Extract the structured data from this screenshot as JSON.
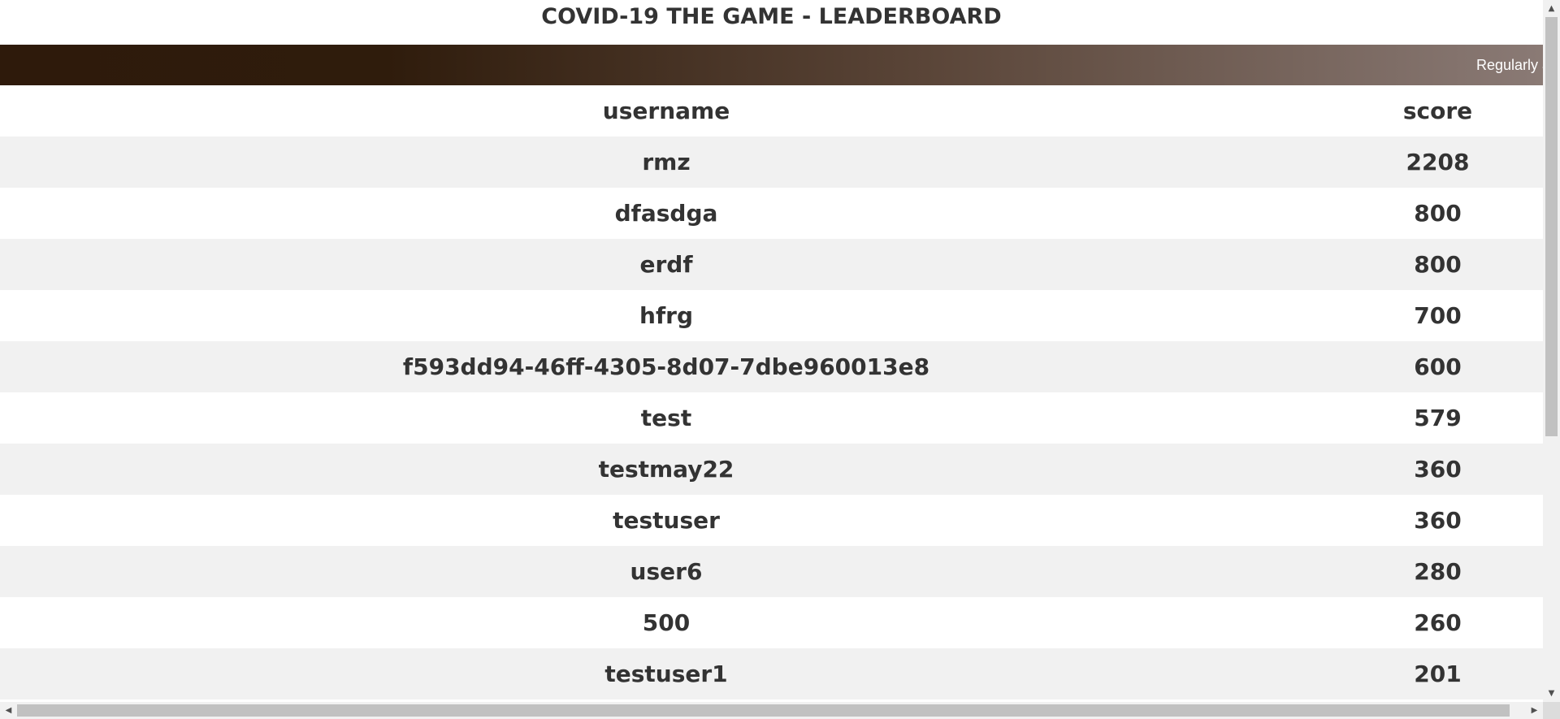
{
  "page": {
    "title": "COVID-19 THE GAME - LEADERBOARD",
    "banner_text": "Regularly a"
  },
  "leaderboard": {
    "columns": [
      "username",
      "score"
    ],
    "rows": [
      {
        "username": "rmz",
        "score": "2208"
      },
      {
        "username": "dfasdga",
        "score": "800"
      },
      {
        "username": "erdf",
        "score": "800"
      },
      {
        "username": "hfrg",
        "score": "700"
      },
      {
        "username": "f593dd94-46ff-4305-8d07-7dbe960013e8",
        "score": "600"
      },
      {
        "username": "test",
        "score": "579"
      },
      {
        "username": "testmay22",
        "score": "360"
      },
      {
        "username": "testuser",
        "score": "360"
      },
      {
        "username": "user6",
        "score": "280"
      },
      {
        "username": "500",
        "score": "260"
      },
      {
        "username": "testuser1",
        "score": "201"
      }
    ]
  },
  "scrollbars": {
    "up_arrow_icon": "▲",
    "down_arrow_icon": "▼",
    "left_arrow_icon": "◀",
    "right_arrow_icon": "▶"
  },
  "colors": {
    "banner_start": "#2e1a0b",
    "banner_end": "#8a7a75",
    "row_stripe": "#f1f1f1",
    "text": "#333333"
  }
}
